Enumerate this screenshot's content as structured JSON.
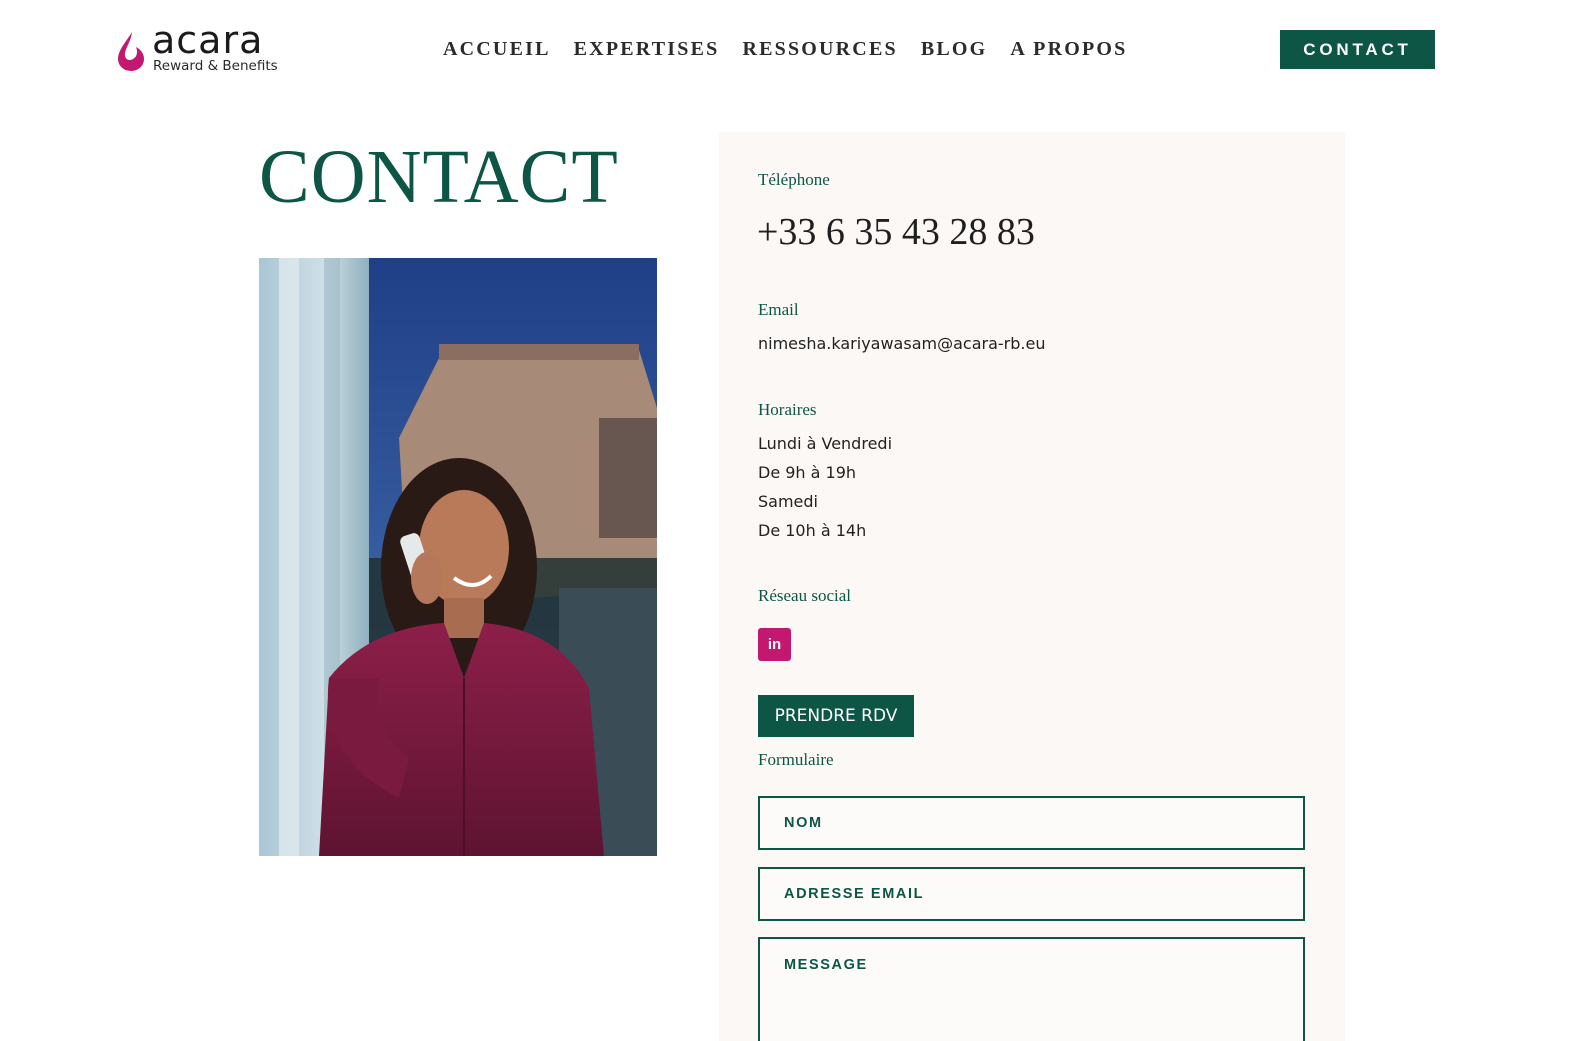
{
  "header": {
    "logo_word": "acara",
    "logo_tagline": "Reward & Benefits",
    "nav": [
      "ACCUEIL",
      "EXPERTISES",
      "RESSOURCES",
      "BLOG",
      "A PROPOS"
    ],
    "contact_label": "CONTACT"
  },
  "main": {
    "title": "CONTACT"
  },
  "contact_info": {
    "phone_label": "Téléphone",
    "phone": "+33 6 35 43 28 83",
    "email_label": "Email",
    "email": "nimesha.kariyawasam@acara-rb.eu",
    "hours_label": "Horaires",
    "hours": [
      "Lundi à Vendredi",
      "De 9h à 19h",
      "Samedi",
      "De 10h à 14h"
    ],
    "social_label": "Réseau social",
    "social_icon": "linkedin-icon",
    "rdv_label": "PRENDRE RDV",
    "form_label": "Formulaire"
  },
  "form": {
    "name_placeholder": "NOM",
    "email_placeholder": "ADRESSE EMAIL",
    "message_placeholder": "MESSAGE"
  },
  "colors": {
    "brand_green": "#0d5646",
    "accent_magenta": "#c2186f",
    "panel_bg": "#fcf8f5"
  }
}
